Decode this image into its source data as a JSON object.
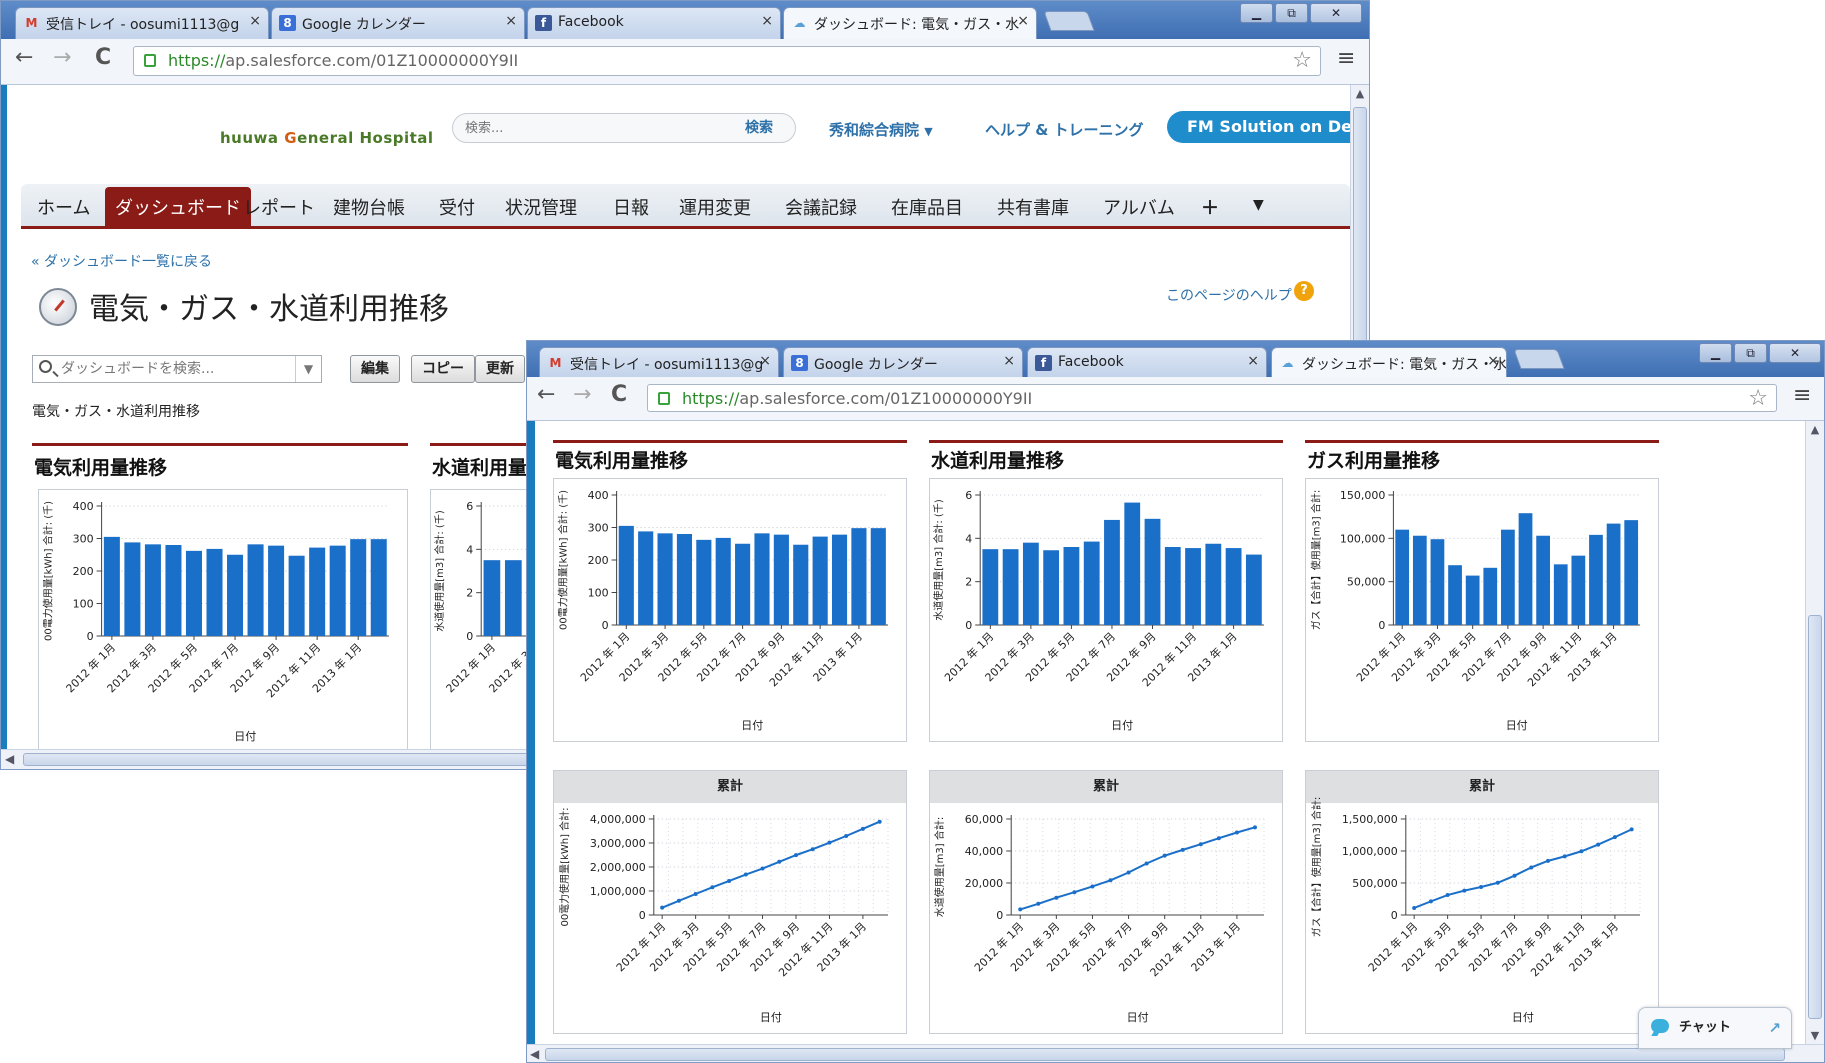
{
  "browser_tabs": [
    {
      "icon": "gmail-icon",
      "title": "受信トレイ - oosumi1113@g",
      "icon_text": "M",
      "icon_color": "#d33b2c"
    },
    {
      "icon": "google-calendar-icon",
      "title": "Google カレンダー",
      "icon_text": "8",
      "icon_color": "#3b6fd8"
    },
    {
      "icon": "facebook-icon",
      "title": "Facebook",
      "icon_text": "f",
      "icon_color": "#3b5998"
    },
    {
      "icon": "salesforce-icon",
      "title": "ダッシュボード: 電気・ガス・水",
      "icon_text": "☁",
      "icon_color": "#5a9fd6"
    }
  ],
  "address": {
    "https": "https://",
    "url": "ap.salesforce.com/01Z10000000Y9II"
  },
  "header": {
    "logo": {
      "pre": "huuwa ",
      "g": "G",
      "post": "eneral Hospital"
    },
    "search_placeholder": "検索...",
    "search_button": "検索",
    "org_menu": "秀和綜合病院",
    "help_training": "ヘルプ & トレーニング",
    "fm_button": "FM Solution on Demand"
  },
  "nav_tabs": [
    "ホーム",
    "ダッシュボード",
    "レポート",
    "建物台帳",
    "受付",
    "状況管理",
    "日報",
    "運用変更",
    "会議記録",
    "在庫品目",
    "共有書庫",
    "アルバム",
    "＋",
    "▼"
  ],
  "page": {
    "back_link": "« ダッシュボード一覧に戻る",
    "title": "電気・ガス・水道利用推移",
    "help_link": "このページのヘルプ",
    "help_q": "?",
    "dashboard_search_placeholder": "ダッシュボードを検索...",
    "btn_edit": "編集",
    "btn_copy": "コピー",
    "btn_refresh": "更新",
    "subtitle": "電気・ガス・水道利用推移"
  },
  "chat_label": "チャット",
  "icons": {
    "back": "←",
    "forward": "→",
    "reload": "C",
    "star": "☆",
    "menu": "≡",
    "minimize": "▁",
    "maximize": "⧉",
    "close": "✕",
    "tab_close": "×",
    "dropdown": "▼",
    "scroll_up": "▲",
    "scroll_down": "▼",
    "scroll_left": "◀",
    "scroll_right": "▶",
    "chat_expand": "↗"
  },
  "colors": {
    "accent_red": "#8b1b16",
    "bar_blue": "#1a6fc9",
    "link_blue": "#2d71a8"
  },
  "chart_data": [
    {
      "type": "bar",
      "panel_title": "電気利用量推移",
      "categories": [
        "2012年1月",
        "2012年2月",
        "2012年3月",
        "2012年4月",
        "2012年5月",
        "2012年6月",
        "2012年7月",
        "2012年8月",
        "2012年9月",
        "2012年10月",
        "2012年11月",
        "2012年12月",
        "2013年1月",
        "2013年2月"
      ],
      "tick_labels": [
        "2012 年 1月",
        "2012 年 3月",
        "2012 年 5月",
        "2012 年 7月",
        "2012 年 9月",
        "2012 年 11月",
        "2013 年 1月"
      ],
      "values": [
        305,
        288,
        282,
        280,
        262,
        268,
        250,
        282,
        278,
        247,
        272,
        278,
        298,
        298
      ],
      "ylim": [
        0,
        400
      ],
      "yticks": [
        "0",
        "100",
        "200",
        "300",
        "400"
      ],
      "ylabel": "00電力使用量[kWh] 合計: (千)",
      "xlabel": "日付"
    },
    {
      "type": "bar",
      "panel_title": "水道利用量推移",
      "categories": [
        "2012年1月",
        "2012年2月",
        "2012年3月",
        "2012年4月",
        "2012年5月",
        "2012年6月",
        "2012年7月",
        "2012年8月",
        "2012年9月",
        "2012年10月",
        "2012年11月",
        "2012年12月",
        "2013年1月",
        "2013年2月"
      ],
      "tick_labels": [
        "2012 年 1月",
        "2012 年 3月",
        "2012 年 5月",
        "2012 年 7月",
        "2012 年 9月",
        "2012 年 11月",
        "2013 年 1月"
      ],
      "values": [
        3.5,
        3.5,
        3.8,
        3.45,
        3.6,
        3.85,
        4.85,
        5.65,
        4.9,
        3.6,
        3.55,
        3.75,
        3.55,
        3.25
      ],
      "ylim": [
        0,
        6
      ],
      "yticks": [
        "0",
        "2",
        "4",
        "6"
      ],
      "ylabel": "水道使用量[m3] 合計: (千)",
      "xlabel": "日付"
    },
    {
      "type": "bar",
      "panel_title": "ガス利用量推移",
      "categories": [
        "2012年1月",
        "2012年2月",
        "2012年3月",
        "2012年4月",
        "2012年5月",
        "2012年6月",
        "2012年7月",
        "2012年8月",
        "2012年9月",
        "2012年10月",
        "2012年11月",
        "2012年12月",
        "2013年1月",
        "2013年2月"
      ],
      "tick_labels": [
        "2012 年 1月",
        "2012 年 3月",
        "2012 年 5月",
        "2012 年 7月",
        "2012 年 9月",
        "2012 年 11月",
        "2013 年 1月"
      ],
      "values": [
        110000,
        103000,
        99000,
        69000,
        57000,
        66000,
        110000,
        129000,
        103000,
        70000,
        80000,
        104000,
        117000,
        121000
      ],
      "ylim": [
        0,
        150000
      ],
      "yticks": [
        "0",
        "50,000",
        "100,000",
        "150,000"
      ],
      "ylabel": "ガス【合計】使用量[m3] 合計:",
      "xlabel": "日付"
    },
    {
      "type": "line",
      "caption": "累計",
      "categories": [
        "2012年1月",
        "2012年2月",
        "2012年3月",
        "2012年4月",
        "2012年5月",
        "2012年6月",
        "2012年7月",
        "2012年8月",
        "2012年9月",
        "2012年10月",
        "2012年11月",
        "2012年12月",
        "2013年1月",
        "2013年2月"
      ],
      "tick_labels": [
        "2012 年 1月",
        "2012 年 3月",
        "2012 年 5月",
        "2012 年 7月",
        "2012 年 9月",
        "2012 年 11月",
        "2013 年 1月"
      ],
      "values": [
        305000,
        593000,
        875000,
        1155000,
        1417000,
        1685000,
        1935000,
        2217000,
        2495000,
        2742000,
        3014000,
        3292000,
        3590000,
        3888000
      ],
      "ylim": [
        0,
        4000000
      ],
      "yticks": [
        "0",
        "1,000,000",
        "2,000,000",
        "3,000,000",
        "4,000,000"
      ],
      "ylabel": "00電力使用量[kWh] 合計:",
      "xlabel": "日付"
    },
    {
      "type": "line",
      "caption": "累計",
      "categories": [
        "2012年1月",
        "2012年2月",
        "2012年3月",
        "2012年4月",
        "2012年5月",
        "2012年6月",
        "2012年7月",
        "2012年8月",
        "2012年9月",
        "2012年10月",
        "2012年11月",
        "2012年12月",
        "2013年1月",
        "2013年2月"
      ],
      "tick_labels": [
        "2012 年 1月",
        "2012 年 3月",
        "2012 年 5月",
        "2012 年 7月",
        "2012 年 9月",
        "2012 年 11月",
        "2013 年 1月"
      ],
      "values": [
        3500,
        7000,
        10800,
        14250,
        17850,
        21700,
        26550,
        32200,
        37100,
        40700,
        44250,
        48000,
        51550,
        54800
      ],
      "ylim": [
        0,
        60000
      ],
      "yticks": [
        "0",
        "20,000",
        "40,000",
        "60,000"
      ],
      "ylabel": "水道使用量[m3] 合計:",
      "xlabel": "日付"
    },
    {
      "type": "line",
      "caption": "累計",
      "categories": [
        "2012年1月",
        "2012年2月",
        "2012年3月",
        "2012年4月",
        "2012年5月",
        "2012年6月",
        "2012年7月",
        "2012年8月",
        "2012年9月",
        "2012年10月",
        "2012年11月",
        "2012年12月",
        "2013年1月",
        "2013年2月"
      ],
      "tick_labels": [
        "2012 年 1月",
        "2012 年 3月",
        "2012 年 5月",
        "2012 年 7月",
        "2012 年 9月",
        "2012 年 11月",
        "2013 年 1月"
      ],
      "values": [
        110000,
        213000,
        312000,
        381000,
        438000,
        504000,
        614000,
        743000,
        846000,
        916000,
        996000,
        1100000,
        1217000,
        1338000
      ],
      "ylim": [
        0,
        1500000
      ],
      "yticks": [
        "0",
        "500,000",
        "1,000,000",
        "1,500,000"
      ],
      "ylabel": "ガス【合計】使用量[m3] 合計:",
      "xlabel": "日付"
    }
  ]
}
